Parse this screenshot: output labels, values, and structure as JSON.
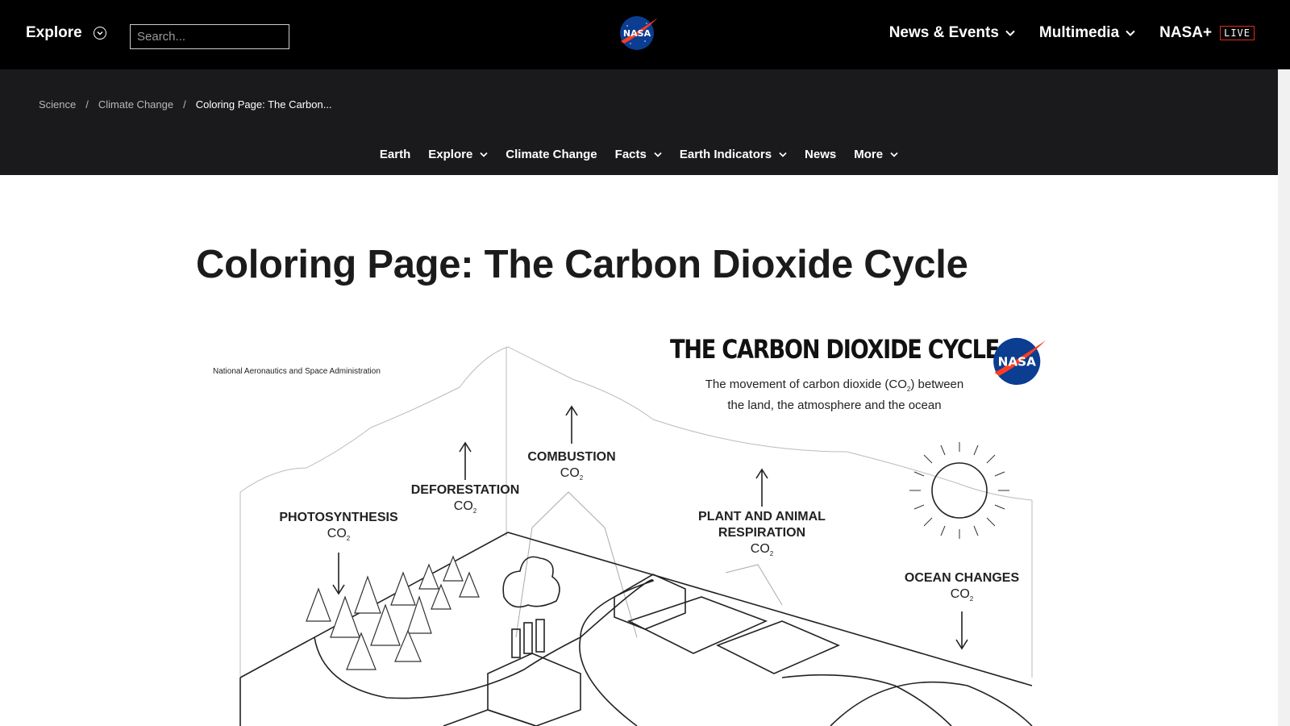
{
  "topbar": {
    "explore_label": "Explore",
    "search_placeholder": "Search...",
    "nav": [
      {
        "label": "News & Events"
      },
      {
        "label": "Multimedia"
      },
      {
        "label": "NASA+"
      }
    ],
    "live_badge": "LIVE"
  },
  "breadcrumb": [
    "Science",
    "Climate Change",
    "Coloring Page: The Carbon..."
  ],
  "subnav": [
    {
      "label": "Earth"
    },
    {
      "label": "Explore"
    },
    {
      "label": "Climate Change"
    },
    {
      "label": "Facts"
    },
    {
      "label": "Earth Indicators"
    },
    {
      "label": "News"
    },
    {
      "label": "More"
    }
  ],
  "page": {
    "title": "Coloring Page: The Carbon Dioxide Cycle"
  },
  "poster": {
    "agency": "National Aeronautics and Space Administration",
    "title": "THE CARBON DIOXIDE CYCLE",
    "subtitle_line1": "The movement of carbon dioxide (CO",
    "subtitle_sub": "2",
    "subtitle_line1b": ") between",
    "subtitle_line2": "the land, the atmosphere and the ocean",
    "labels": {
      "photosynthesis": "PHOTOSYNTHESIS",
      "deforestation": "DEFORESTATION",
      "combustion": "COMBUSTION",
      "respiration_1": "PLANT AND ANIMAL",
      "respiration_2": "RESPIRATION",
      "ocean": "OCEAN CHANGES",
      "co": "CO",
      "sub": "2"
    }
  },
  "icons": {
    "explore_toggle": "chevron-circle-icon",
    "dropdown": "chevron-down-icon",
    "logo": "nasa-logo"
  },
  "colors": {
    "topbar_bg": "#000000",
    "band_bg": "#1a1a1c",
    "nasa_blue": "#0b3d91",
    "nasa_red": "#fc3d21",
    "live_red": "#e0291b"
  }
}
